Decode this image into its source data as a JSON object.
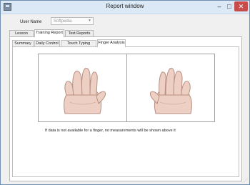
{
  "window": {
    "title": "Report window",
    "minimize_glyph": "–",
    "maximize_glyph": "□",
    "close_glyph": "✕",
    "icon": "app-icon"
  },
  "user": {
    "label": "User Name",
    "value": "Softpedia",
    "dropdown_icon": "chevron-down-icon"
  },
  "main_tabs": [
    {
      "label": "Lesson Report",
      "active": false
    },
    {
      "label": "Training Report",
      "active": true
    },
    {
      "label": "Test Reports",
      "active": false
    }
  ],
  "sub_tabs": [
    {
      "label": "Summary",
      "active": false
    },
    {
      "label": "Daily Control",
      "active": false
    },
    {
      "label": "Touch Typing Analysis",
      "active": false
    },
    {
      "label": "Finger Analysis",
      "active": true
    }
  ],
  "finger_analysis": {
    "left_hand_icon": "left-hand-icon",
    "right_hand_icon": "right-hand-icon",
    "note": "If data is not available for a finger, no measurements will be shown above it"
  },
  "colors": {
    "titlebar": "#dbe8f6",
    "close_button": "#c74d4d",
    "hand_fill": "#eecfc3",
    "hand_stroke": "#b88f82"
  }
}
